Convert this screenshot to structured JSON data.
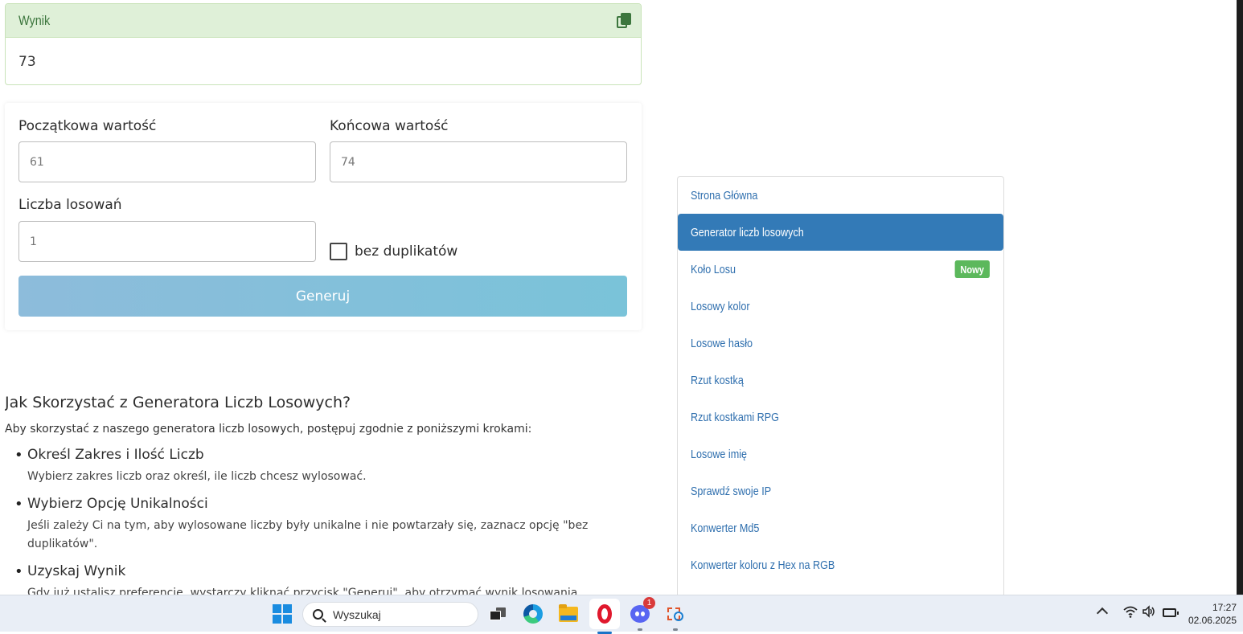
{
  "result": {
    "title": "Wynik",
    "value": "73"
  },
  "form": {
    "start_label": "Początkowa wartość",
    "start_value": "61",
    "end_label": "Końcowa wartość",
    "end_value": "74",
    "count_label": "Liczba losowań",
    "count_value": "1",
    "no_duplicates_label": "bez duplikatów",
    "no_duplicates_checked": false,
    "generate_label": "Generuj"
  },
  "article": {
    "heading": "Jak Skorzystać z Generatora Liczb Losowych?",
    "intro": "Aby skorzystać z naszego generatora liczb losowych, postępuj zgodnie z poniższymi krokami:",
    "steps": [
      {
        "title": "Określ Zakres i Ilość Liczb",
        "desc": "Wybierz zakres liczb oraz określ, ile liczb chcesz wylosować."
      },
      {
        "title": "Wybierz Opcję Unikalności",
        "desc": "Jeśli zależy Ci na tym, aby wylosowane liczby były unikalne i nie powtarzały się, zaznacz opcję \"bez duplikatów\"."
      },
      {
        "title": "Uzyskaj Wynik",
        "desc": "Gdy już ustalisz preferencje, wystarczy kliknąć przycisk \"Generuj\", aby otrzymać wynik losowania."
      }
    ]
  },
  "sidebar": {
    "items": [
      {
        "label": "Strona Główna"
      },
      {
        "label": "Generator liczb losowych",
        "active": true
      },
      {
        "label": "Koło Losu",
        "badge": "Nowy"
      },
      {
        "label": "Losowy kolor"
      },
      {
        "label": "Losowe hasło"
      },
      {
        "label": "Rzut kostką"
      },
      {
        "label": "Rzut kostkami RPG"
      },
      {
        "label": "Losowe imię"
      },
      {
        "label": "Sprawdź swoje IP"
      },
      {
        "label": "Konwerter Md5"
      },
      {
        "label": "Konwerter koloru z Hex na RGB"
      }
    ]
  },
  "taskbar": {
    "search_placeholder": "Wyszukaj",
    "discord_badge": "1",
    "time": "17:27",
    "date": "02.06.2025",
    "icons": [
      "windows-start-icon",
      "search-icon",
      "task-view-icon",
      "edge-icon",
      "file-explorer-icon",
      "opera-icon",
      "discord-icon",
      "snipping-tool-icon",
      "chevron-up-icon",
      "wifi-icon",
      "volume-icon",
      "battery-icon"
    ]
  },
  "colors": {
    "result_header_bg": "#dff0d8",
    "result_title": "#3c763d",
    "generate_button": "#8dbcdb",
    "nav_active": "#337ab7",
    "nav_link": "#2f6fae",
    "badge_new": "#5cb85c"
  }
}
